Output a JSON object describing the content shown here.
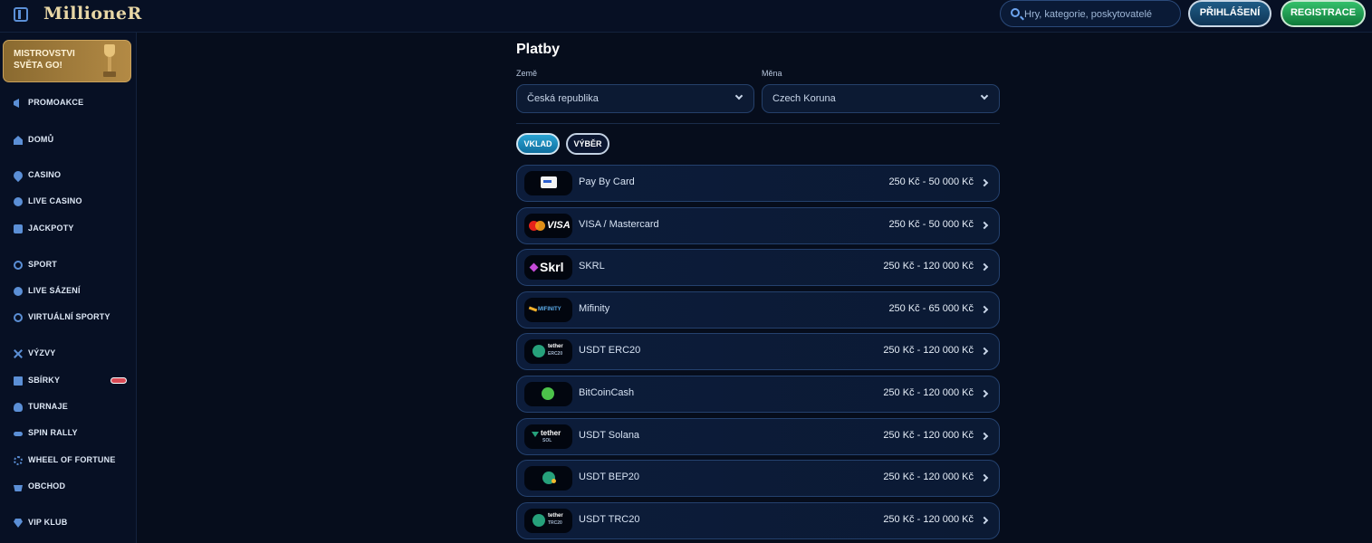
{
  "header": {
    "logo": "MillioneR",
    "search_placeholder": "Hry, kategorie, poskytovatelé",
    "login_label": "PŘIHLÁŠENÍ",
    "register_label": "REGISTRACE"
  },
  "sidebar": {
    "banner_line1": "MISTROVSTVI",
    "banner_line2": "SVĚTA GO!",
    "items": [
      {
        "label": "PROMOAKCE",
        "icon": "megaphone-icon"
      },
      {
        "label": "DOMŮ",
        "icon": "home-icon"
      },
      {
        "label": "CASINO",
        "icon": "spade-icon"
      },
      {
        "label": "LIVE CASINO",
        "icon": "live-casino-icon"
      },
      {
        "label": "JACKPOTY",
        "icon": "jackpot-icon"
      },
      {
        "label": "SPORT",
        "icon": "soccer-ball-icon"
      },
      {
        "label": "LIVE SÁZENÍ",
        "icon": "live-betting-icon"
      },
      {
        "label": "VIRTUÁLNÍ SPORTY",
        "icon": "virtual-sports-icon"
      },
      {
        "label": "VÝZVY",
        "icon": "challenges-icon"
      },
      {
        "label": "SBÍRKY",
        "icon": "collections-icon"
      },
      {
        "label": "TURNAJE",
        "icon": "tournament-icon"
      },
      {
        "label": "SPIN RALLY",
        "icon": "spin-rally-icon"
      },
      {
        "label": "WHEEL OF FORTUNE",
        "icon": "wheel-icon"
      },
      {
        "label": "OBCHOD",
        "icon": "shop-basket-icon"
      },
      {
        "label": "VIP KLUB",
        "icon": "diamond-icon"
      }
    ]
  },
  "main": {
    "title": "Platby",
    "country_label": "Země",
    "country_value": "Česká republika",
    "currency_label": "Měna",
    "currency_value": "Czech Koruna",
    "tab_deposit": "VKLAD",
    "tab_withdraw": "VÝBĚR",
    "methods": [
      {
        "name": "Pay By Card",
        "range": "250 Kč - 50 000 Kč"
      },
      {
        "name": "VISA / Mastercard",
        "range": "250 Kč - 50 000 Kč"
      },
      {
        "name": "SKRL",
        "range": "250 Kč - 120 000 Kč"
      },
      {
        "name": "Mifinity",
        "range": "250 Kč - 65 000 Kč"
      },
      {
        "name": "USDT ERC20",
        "range": "250 Kč - 120 000 Kč"
      },
      {
        "name": "BitCoinCash",
        "range": "250 Kč - 120 000 Kč"
      },
      {
        "name": "USDT Solana",
        "range": "250 Kč - 120 000 Kč"
      },
      {
        "name": "USDT BEP20",
        "range": "250 Kč - 120 000 Kč"
      },
      {
        "name": "USDT TRC20",
        "range": "250 Kč - 120 000 Kč"
      }
    ],
    "logo_texts": {
      "visa": "VISA",
      "skrl": "Skrl",
      "mifinity": "MIFINITY",
      "tether": "tether",
      "erc20": "ERC20",
      "sol": "SOL",
      "trc20": "TRC20"
    }
  },
  "colors": {
    "background": "#060d1c",
    "accent": "#2aa3d2",
    "register": "#34c06b",
    "badge": "#d94a55"
  }
}
